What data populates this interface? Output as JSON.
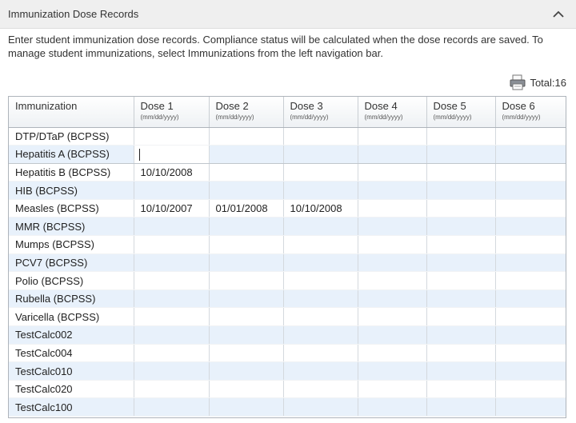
{
  "panel": {
    "title": "Immunization Dose Records"
  },
  "intro_text": "Enter student immunization dose records. Compliance status will be calculated when the dose records are saved. To manage student immunizations, select Immunizations from the left navigation bar.",
  "total_label": "Total:16",
  "grid": {
    "headers": [
      {
        "label": "Immunization",
        "sub": ""
      },
      {
        "label": "Dose 1",
        "sub": "(mm/dd/yyyy)"
      },
      {
        "label": "Dose 2",
        "sub": "(mm/dd/yyyy)"
      },
      {
        "label": "Dose 3",
        "sub": "(mm/dd/yyyy)"
      },
      {
        "label": "Dose 4",
        "sub": "(mm/dd/yyyy)"
      },
      {
        "label": "Dose 5",
        "sub": "(mm/dd/yyyy)"
      },
      {
        "label": "Dose 6",
        "sub": "(mm/dd/yyyy)"
      }
    ],
    "rows": [
      [
        "DTP/DTaP (BCPSS)",
        "",
        "",
        "",
        "",
        "",
        ""
      ],
      [
        "Hepatitis A (BCPSS)",
        "",
        "",
        "",
        "",
        "",
        ""
      ],
      [
        "Hepatitis B (BCPSS)",
        "10/10/2008",
        "",
        "",
        "",
        "",
        ""
      ],
      [
        "HIB (BCPSS)",
        "",
        "",
        "",
        "",
        "",
        ""
      ],
      [
        "Measles (BCPSS)",
        "10/10/2007",
        "01/01/2008",
        "10/10/2008",
        "",
        "",
        ""
      ],
      [
        "MMR (BCPSS)",
        "",
        "",
        "",
        "",
        "",
        ""
      ],
      [
        "Mumps (BCPSS)",
        "",
        "",
        "",
        "",
        "",
        ""
      ],
      [
        "PCV7 (BCPSS)",
        "",
        "",
        "",
        "",
        "",
        ""
      ],
      [
        "Polio (BCPSS)",
        "",
        "",
        "",
        "",
        "",
        ""
      ],
      [
        "Rubella (BCPSS)",
        "",
        "",
        "",
        "",
        "",
        ""
      ],
      [
        "Varicella (BCPSS)",
        "",
        "",
        "",
        "",
        "",
        ""
      ],
      [
        "TestCalc002",
        "",
        "",
        "",
        "",
        "",
        ""
      ],
      [
        "TestCalc004",
        "",
        "",
        "",
        "",
        "",
        ""
      ],
      [
        "TestCalc010",
        "",
        "",
        "",
        "",
        "",
        ""
      ],
      [
        "TestCalc020",
        "",
        "",
        "",
        "",
        "",
        ""
      ],
      [
        "TestCalc100",
        "",
        "",
        "",
        "",
        "",
        ""
      ]
    ],
    "editing_cell": {
      "row": 1,
      "col": 1
    }
  },
  "icons": {
    "collapse": "chevron-up-icon",
    "print": "printer-icon"
  }
}
